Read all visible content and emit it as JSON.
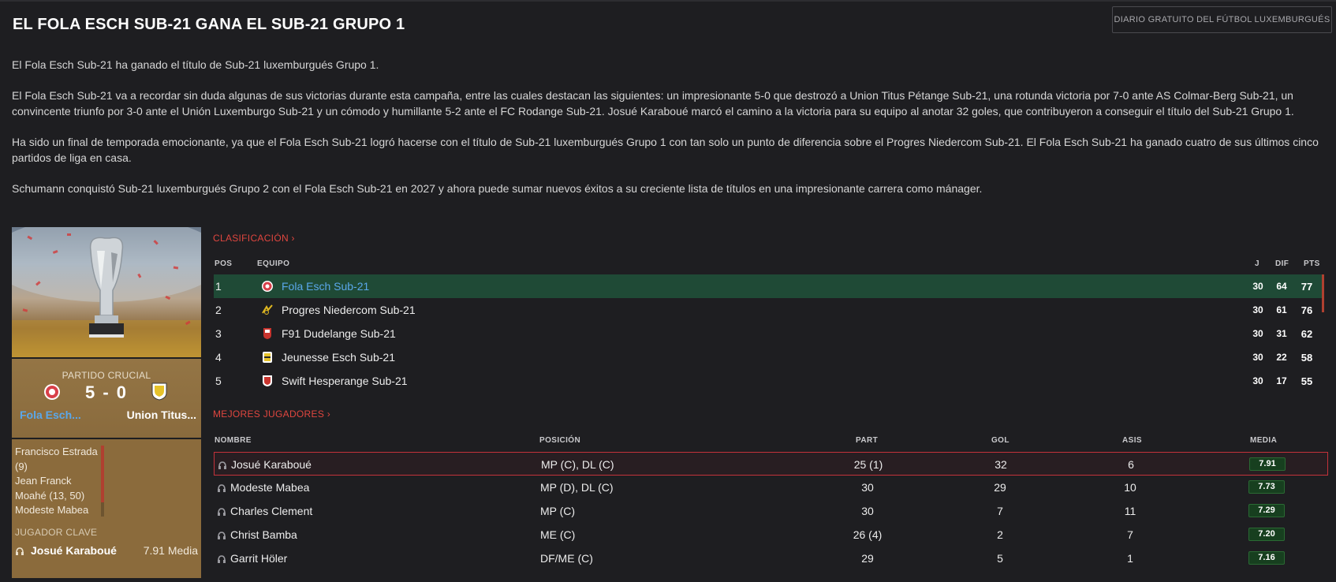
{
  "article": {
    "headline": "EL FOLA ESCH SUB-21 GANA EL SUB-21 GRUPO 1",
    "source": "DIARIO GRATUITO DEL FÚTBOL LUXEMBURGUÉS",
    "paragraphs": [
      "El Fola Esch Sub-21 ha ganado el título de Sub-21 luxemburgués Grupo 1.",
      "El Fola Esch Sub-21 va a recordar sin duda algunas de sus victorias durante esta campaña, entre las cuales destacan las siguientes: un impresionante 5-0 que destrozó a Union Titus Pétange Sub-21, una rotunda victoria por 7-0 ante AS Colmar-Berg Sub-21, un convincente triunfo por 3-0 ante el Unión Luxemburgo Sub-21 y un cómodo y humillante 5-2 ante el FC Rodange Sub-21. Josué Karaboué marcó el camino a la victoria para su equipo al anotar 32 goles, que contribuyeron a conseguir el título del Sub-21 Grupo 1.",
      "Ha sido un final de temporada emocionante, ya que el Fola Esch Sub-21 logró hacerse con el título de Sub-21 luxemburgués Grupo 1 con tan solo un punto de diferencia sobre el Progres Niedercom Sub-21. El Fola Esch Sub-21 ha ganado cuatro de sus últimos cinco partidos de liga en casa.",
      "Schumann conquistó Sub-21 luxemburgués Grupo 2 con el Fola Esch Sub-21 en 2027 y ahora puede sumar nuevos éxitos a su creciente lista de títulos en una impresionante carrera como mánager."
    ]
  },
  "crucial_match": {
    "label": "PARTIDO CRUCIAL",
    "score": "5 - 0",
    "home": "Fola Esch...",
    "away": "Union Titus...",
    "scorers": [
      "Francisco Estrada",
      "(9)",
      "Jean Franck",
      "Moahé (13, 50)",
      "Modeste Mabea"
    ],
    "key_player_label": "JUGADOR CLAVE",
    "key_player": "Josué Karaboué",
    "key_player_rating": "7.91 Media"
  },
  "standings": {
    "link": "CLASIFICACIÓN ›",
    "headers": {
      "pos": "POS",
      "team": "EQUIPO",
      "j": "J",
      "dif": "DIF",
      "pts": "PTS"
    },
    "rows": [
      {
        "pos": "1",
        "team": "Fola Esch Sub-21",
        "j": "30",
        "dif": "64",
        "pts": "77",
        "crest": "#d8404a"
      },
      {
        "pos": "2",
        "team": "Progres Niedercom Sub-21",
        "j": "30",
        "dif": "61",
        "pts": "76",
        "crest": "#e0b820"
      },
      {
        "pos": "3",
        "team": "F91 Dudelange Sub-21",
        "j": "30",
        "dif": "31",
        "pts": "62",
        "crest": "#c8342e"
      },
      {
        "pos": "4",
        "team": "Jeunesse Esch Sub-21",
        "j": "30",
        "dif": "22",
        "pts": "58",
        "crest": "#e6c22a"
      },
      {
        "pos": "5",
        "team": "Swift Hesperange Sub-21",
        "j": "30",
        "dif": "17",
        "pts": "55",
        "crest": "#c8342e"
      }
    ]
  },
  "players": {
    "link": "MEJORES JUGADORES ›",
    "headers": {
      "name": "NOMBRE",
      "position": "POSICIÓN",
      "apps": "PART",
      "goals": "GOL",
      "assists": "ASIS",
      "rating": "MEDIA"
    },
    "rows": [
      {
        "name": "Josué Karaboué",
        "position": "MP (C), DL (C)",
        "apps": "25 (1)",
        "goals": "32",
        "assists": "6",
        "rating": "7.91"
      },
      {
        "name": "Modeste Mabea",
        "position": "MP (D), DL (C)",
        "apps": "30",
        "goals": "29",
        "assists": "10",
        "rating": "7.73"
      },
      {
        "name": "Charles Clement",
        "position": "MP (C)",
        "apps": "30",
        "goals": "7",
        "assists": "11",
        "rating": "7.29"
      },
      {
        "name": "Christ Bamba",
        "position": "ME (C)",
        "apps": "26 (4)",
        "goals": "2",
        "assists": "7",
        "rating": "7.20"
      },
      {
        "name": "Garrit Höler",
        "position": "DF/ME (C)",
        "apps": "29",
        "goals": "5",
        "assists": "1",
        "rating": "7.16"
      }
    ]
  },
  "colors": {
    "accent_red": "#e0463f",
    "highlight_green": "#1f4a36",
    "link_blue": "#5aa7ea",
    "panel_gold": "#8b6b3c"
  }
}
